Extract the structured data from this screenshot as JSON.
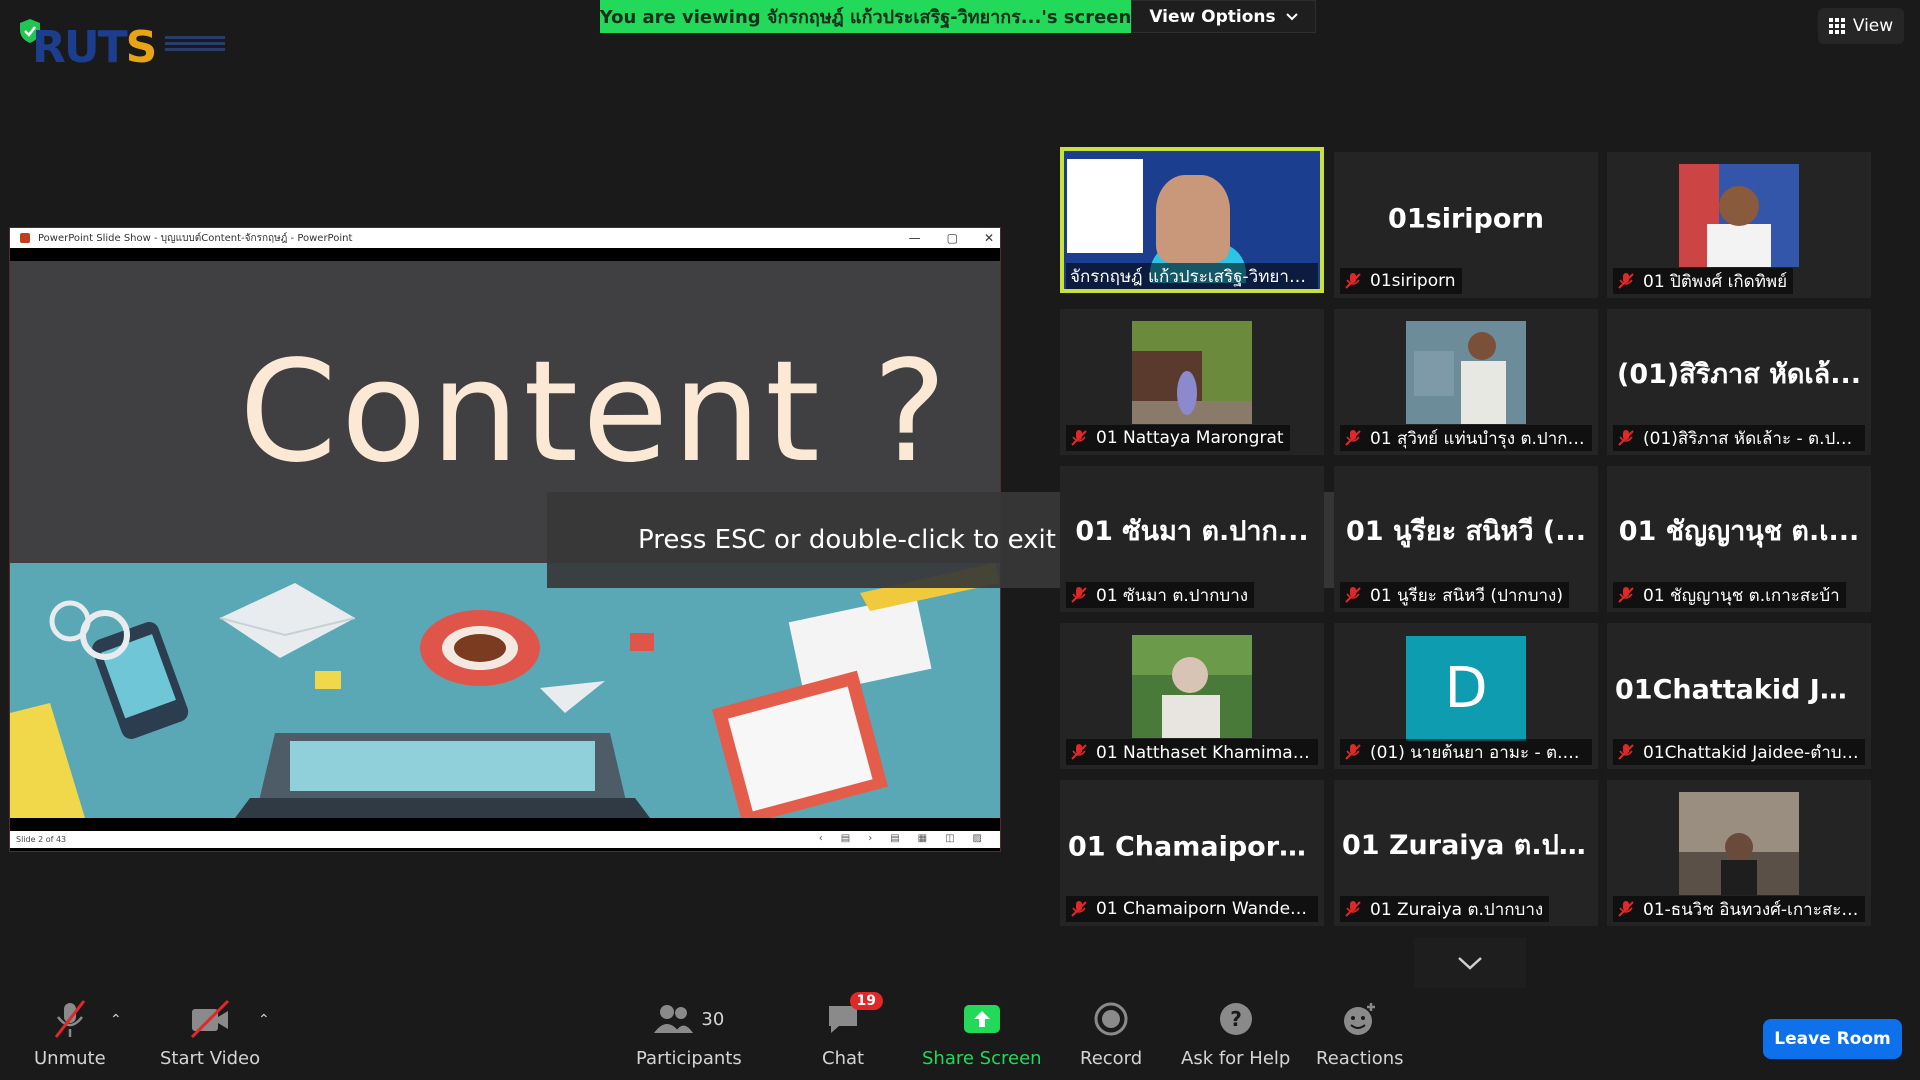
{
  "banner": {
    "viewing_text": "You are viewing จักรกฤษฎ์ แก้วประเสริฐ-วิทยากร...'s screen",
    "view_options": "View Options"
  },
  "view_button": {
    "label": "View"
  },
  "share": {
    "window_title": "PowerPoint Slide Show  -  บุญแบบต์Content-จักรกฤษฎ์  -  PowerPoint",
    "slide_title": "Content ?",
    "status": "Slide 2 of 43"
  },
  "toast": "Press ESC or double-click to exit full screen mode",
  "tiles": [
    {
      "name": "",
      "label": "จักรกฤษฎ์ แก้วประเสริฐ-วิทยากรY...",
      "kind": "video",
      "active": true,
      "muted": false
    },
    {
      "name": "01siriporn",
      "label": "01siriporn",
      "kind": "name",
      "muted": true
    },
    {
      "name": "",
      "label": "01 ปิติพงศ์ เกิดทิพย์",
      "kind": "photo",
      "muted": true
    },
    {
      "name": "",
      "label": "01 Nattaya Marongrat",
      "kind": "photo",
      "muted": true
    },
    {
      "name": "",
      "label": "01 สุวิทย์ แท่นบำรุง ต.ปากบาง",
      "kind": "photo",
      "muted": true
    },
    {
      "name": "(01)สิริภาส หัดเล้...",
      "label": "(01)สิริภาส หัดเล้าะ - ต.ปากบ...",
      "kind": "name",
      "muted": true
    },
    {
      "name": "01 ซันมา ต.ปาก...",
      "label": "01 ซันมา ต.ปากบาง",
      "kind": "name",
      "muted": true
    },
    {
      "name": "01 นูรียะ สนิหวี (...",
      "label": "01 นูรียะ สนิหวี  (ปากบาง)",
      "kind": "name",
      "muted": true
    },
    {
      "name": "01 ชัญญานุช ต.เ...",
      "label": "01 ชัญญานุช ต.เกาะสะบ้า",
      "kind": "name",
      "muted": true
    },
    {
      "name": "",
      "label": "01 Natthaset Khamima ต....",
      "kind": "photo",
      "muted": true
    },
    {
      "name": "D",
      "label": "(01) นายต้นยา อามะ - ต.ปาก...",
      "kind": "avatar",
      "muted": true
    },
    {
      "name": "01Chattakid  Jai...",
      "label": "01Chattakid Jaidee-ตำบล...",
      "kind": "name",
      "muted": true
    },
    {
      "name": "01  Chamaiporn...",
      "label": "01 Chamaiporn Wanden ...",
      "kind": "name",
      "muted": true
    },
    {
      "name": "01  Zuraiya ต.ปา...",
      "label": "01 Zuraiya ต.ปากบาง",
      "kind": "name",
      "muted": true
    },
    {
      "name": "",
      "label": "01-ธนวิช อินทวงศ์-เกาะสะบ้า",
      "kind": "photo",
      "muted": true
    }
  ],
  "toolbar": {
    "unmute": "Unmute",
    "start_video": "Start Video",
    "participants": "Participants",
    "participants_count": "30",
    "chat": "Chat",
    "chat_badge": "19",
    "share_screen": "Share Screen",
    "record": "Record",
    "ask_for_help": "Ask for Help",
    "reactions": "Reactions",
    "leave_room": "Leave Room"
  },
  "colors": {
    "banner_green": "#23d959",
    "share_green": "#23d959",
    "leave_blue": "#0e71eb",
    "badge_red": "#e02828",
    "active_outline": "#c7e23a"
  }
}
